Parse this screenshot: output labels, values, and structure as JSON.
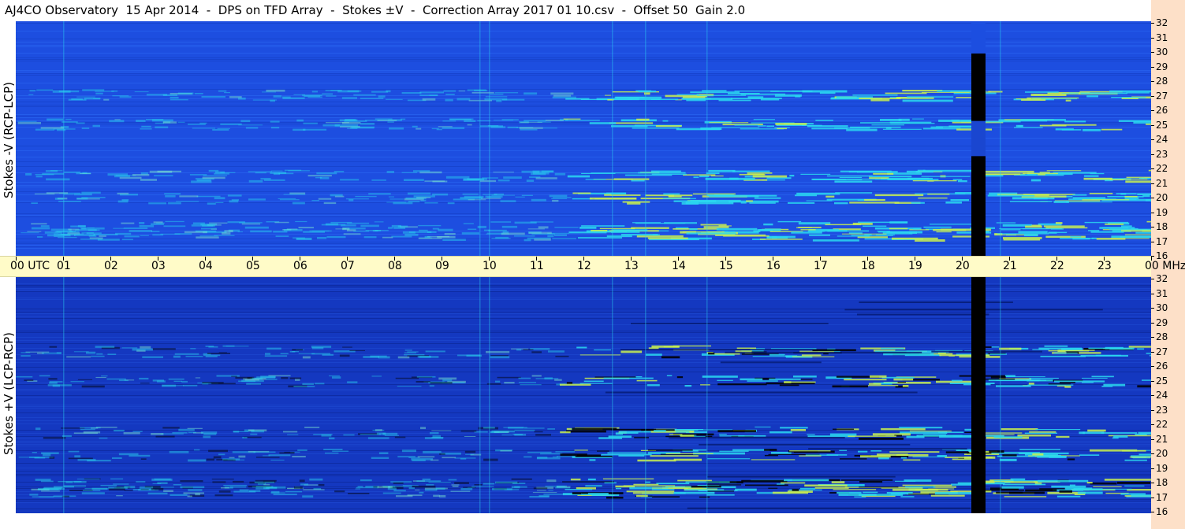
{
  "title": "AJ4CO Observatory  15 Apr 2014  -  DPS on TFD Array  -  Stokes ±V  -  Correction Array 2017 01 10.csv  -  Offset 50  Gain 2.0",
  "colors": {
    "background_blue": "#1a48d8",
    "dark_blue": "#0a2aa0",
    "cyan": "#2ad8f0",
    "yellow_green": "#c8f050",
    "black": "#000000",
    "axis_strip": "#fffbc8",
    "right_margin": "#fde0c8"
  },
  "chart_data": {
    "type": "heatmap",
    "description_panels": [
      {
        "ylabel": "Stokes -V (RCP-LCP)"
      },
      {
        "ylabel": "Stokes +V (LCP-RCP)"
      }
    ],
    "x_ticks": [
      "00 UTC",
      "01",
      "02",
      "03",
      "04",
      "05",
      "06",
      "07",
      "08",
      "09",
      "10",
      "11",
      "12",
      "13",
      "14",
      "15",
      "16",
      "17",
      "18",
      "19",
      "20",
      "21",
      "22",
      "23",
      "00 MHz"
    ],
    "xlim": [
      0,
      24
    ],
    "y_ticks": [
      "32",
      "31",
      "30",
      "29",
      "28",
      "27",
      "26",
      "25",
      "24",
      "23",
      "22",
      "21",
      "20",
      "19",
      "18",
      "17",
      "16"
    ],
    "ylim": [
      16,
      32
    ],
    "gap_utc": [
      20.2,
      20.5
    ],
    "bright_bands_mhz": [
      27,
      25,
      21.5,
      20,
      18,
      17.5
    ],
    "grid": false
  }
}
